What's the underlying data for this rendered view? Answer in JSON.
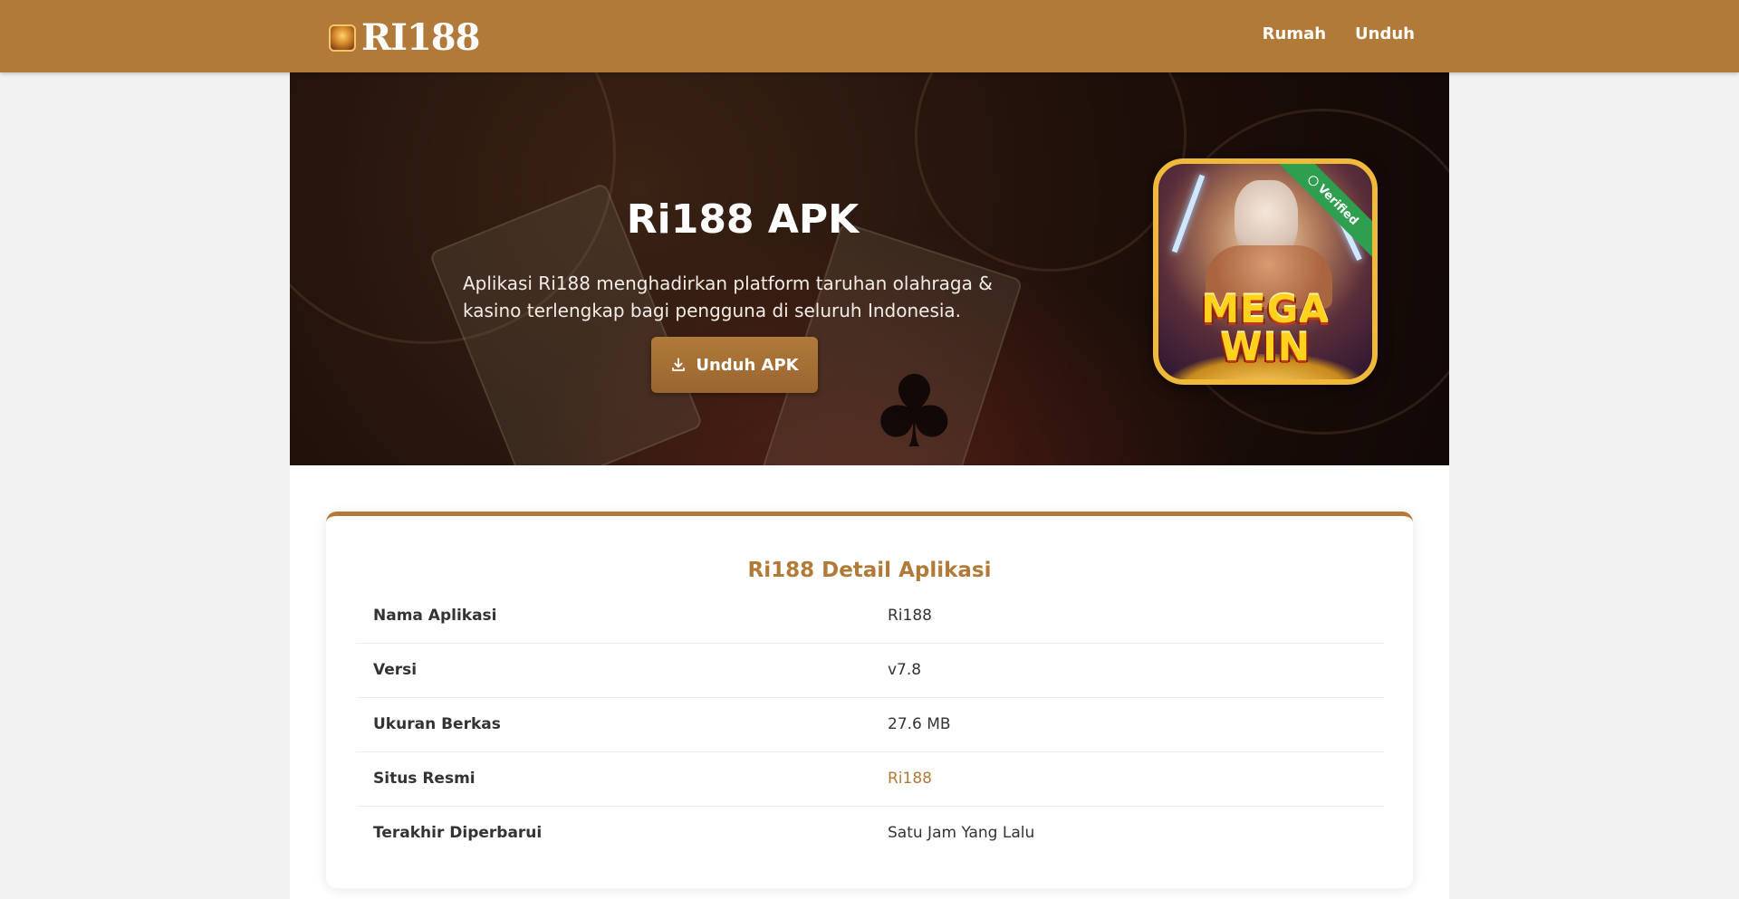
{
  "header": {
    "logo_text": "RI188",
    "nav": [
      {
        "label": "Rumah"
      },
      {
        "label": "Unduh"
      }
    ]
  },
  "hero": {
    "title": "Ri188 APK",
    "description": "Aplikasi Ri188 menghadirkan platform taruhan olahraga & kasino terlengkap bagi pengguna di seluruh Indonesia.",
    "button_label": "Unduh APK",
    "app_icon": {
      "banner_text": "MEGA WIN",
      "ribbon_text": "Verified"
    }
  },
  "details": {
    "title": "Ri188 Detail Aplikasi",
    "rows": [
      {
        "key": "Nama Aplikasi",
        "value": "Ri188"
      },
      {
        "key": "Versi",
        "value": "v7.8"
      },
      {
        "key": "Ukuran Berkas",
        "value": "27.6 MB"
      },
      {
        "key": "Situs Resmi",
        "value": "Ri188"
      },
      {
        "key": "Terakhir Diperbarui",
        "value": "Satu Jam Yang Lalu"
      }
    ]
  },
  "colors": {
    "brand": "#b27a39",
    "verified": "#2f9e4f"
  }
}
